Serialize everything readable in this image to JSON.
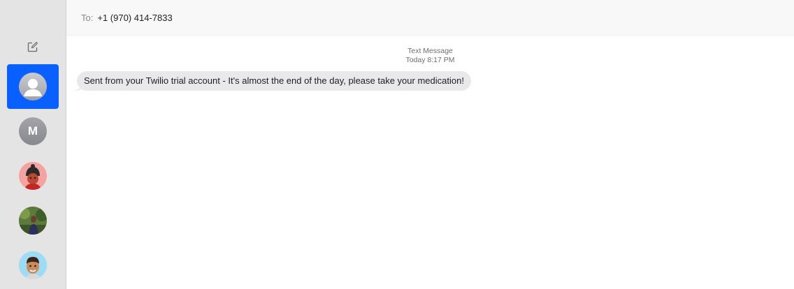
{
  "app": {
    "accent": "#0a60ff"
  },
  "sidebar": {
    "compose_icon": "compose-icon",
    "conversations": [
      {
        "id": "unknown-contact",
        "avatar_type": "generic-person",
        "selected": true
      },
      {
        "id": "contact-m",
        "avatar_type": "letter",
        "letter": "M",
        "selected": false
      },
      {
        "id": "contact-memoji-hat",
        "avatar_type": "photo",
        "selected": false
      },
      {
        "id": "contact-photo-outdoor",
        "avatar_type": "photo",
        "selected": false
      },
      {
        "id": "contact-memoji-boy",
        "avatar_type": "photo",
        "selected": false
      }
    ]
  },
  "header": {
    "to_label": "To:",
    "recipient": "+1 (970) 414-7833"
  },
  "transcript": {
    "service": "Text Message",
    "day": "Today",
    "time": "8:17 PM",
    "messages": [
      {
        "direction": "incoming",
        "text": "Sent from your Twilio trial account - It's almost the end of the day, please take your medication!"
      }
    ]
  }
}
